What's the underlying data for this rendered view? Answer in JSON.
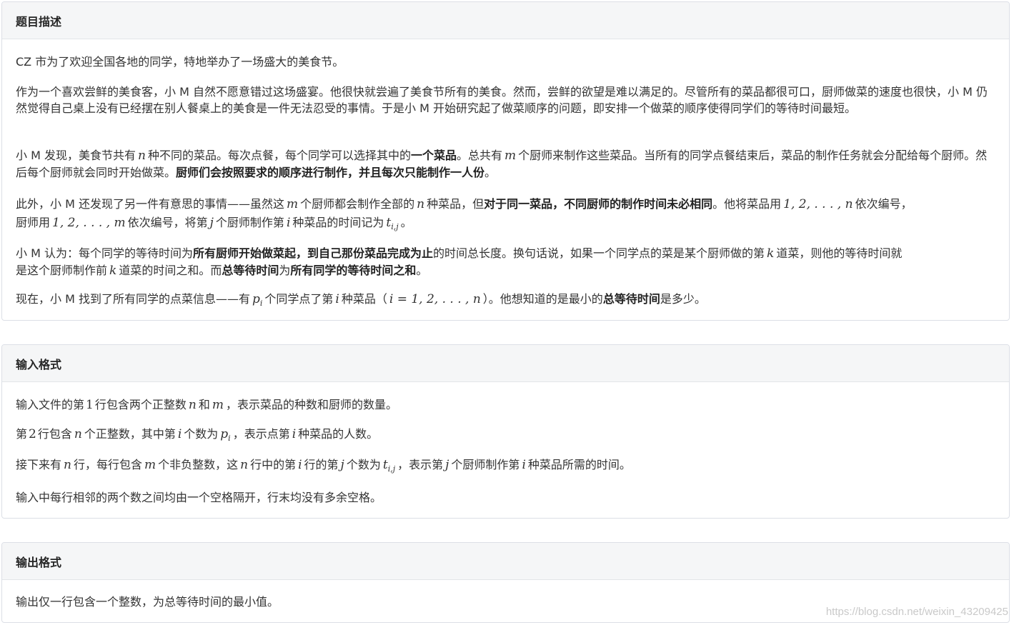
{
  "sections": {
    "description": {
      "title": "题目描述",
      "p1": "CZ 市为了欢迎全国各地的同学，特地举办了一场盛大的美食节。",
      "p2": "作为一个喜欢尝鲜的美食客，小 M 自然不愿意错过这场盛宴。他很快就尝遍了美食节所有的美食。然而，尝鲜的欲望是难以满足的。尽管所有的菜品都很可口，厨师做菜的速度也很快，小 M 仍然觉得自己桌上没有已经摆在别人餐桌上的美食是一件无法忍受的事情。于是小 M 开始研究起了做菜顺序的问题，即安排一个做菜的顺序使得同学们的等待时间最短。",
      "p3": {
        "a": "小 M 发现，美食节共有",
        "n": "n",
        "b": "种不同的菜品。每次点餐，每个同学可以选择其中的",
        "bold1": "一个菜品",
        "c": "。总共有",
        "m": "m",
        "d": "个厨师来制作这些菜品。当所有的同学点餐结束后，菜品的制作任务就会分配给每个厨师。然后每个厨师就会同时开始做菜。",
        "bold2": "厨师们会按照要求的顺序进行制作，并且每次只能制作一人份",
        "e": "。"
      },
      "p4": {
        "a": "此外，小 M 还发现了另一件有意思的事情——虽然这",
        "m": "m",
        "b": "个厨师都会制作全部的",
        "n": "n",
        "c": "种菜品，但",
        "bold1": "对于同一菜品，不同厨师的制作时间未必相同",
        "d": "。他将菜品用",
        "seq_n": "1, 2, . . . , n",
        "e": "依次编号，",
        "f": "厨师用",
        "seq_m": "1, 2, . . . , m",
        "g": "依次编号，将第",
        "j": "j",
        "h": "个厨师制作第",
        "i": "i",
        "k": "种菜品的时间记为",
        "t": "t",
        "tsub": "i,j",
        "end": "。"
      },
      "p5": {
        "a": "小 M 认为：每个同学的等待时间为",
        "bold1": "所有厨师开始做菜起，到自己那份菜品完成为止",
        "b": "的时间总长度。换句话说，如果一个同学点的菜是某个厨师做的第",
        "k1": "k",
        "c": "道菜，则他的等待时间就",
        "d": "是这个厨师制作前",
        "k2": "k",
        "e": "道菜的时间之和。而",
        "bold2": "总等待时间",
        "f": "为",
        "bold3": "所有同学的等待时间之和",
        "g": "。"
      },
      "p6": {
        "a": "现在，小 M 找到了所有同学的点菜信息——有",
        "p": "p",
        "psub": "i",
        "b": "个同学点了第",
        "i": "i",
        "c": "种菜品（",
        "range": "i = 1, 2, . . . , n",
        "d": "）。他想知道的是最小的",
        "bold1": "总等待时间",
        "e": "是多少。"
      }
    },
    "input": {
      "title": "输入格式",
      "l1": {
        "a": "输入文件的第",
        "one": "1",
        "b": "行包含两个正整数",
        "n": "n",
        "c": "和",
        "m": "m",
        "d": "，表示菜品的种数和厨师的数量。"
      },
      "l2": {
        "a": "第",
        "two": "2",
        "b": "行包含",
        "n": "n",
        "c": "个正整数，其中第",
        "i": "i",
        "d": "个数为",
        "p": "p",
        "psub": "i",
        "e": "，表示点第",
        "i2": "i",
        "f": "种菜品的人数。"
      },
      "l3": {
        "a": "接下来有",
        "n": "n",
        "b": "行，每行包含",
        "m": "m",
        "c": "个非负整数，这",
        "n2": "n",
        "d": "行中的第",
        "i": "i",
        "e": "行的第",
        "j": "j",
        "f": "个数为",
        "t": "t",
        "tsub": "i,j",
        "g": "，表示第",
        "j2": "j",
        "h": "个厨师制作第",
        "i2": "i",
        "k": "种菜品所需的时间。"
      },
      "l4": "输入中每行相邻的两个数之间均由一个空格隔开，行末均没有多余空格。"
    },
    "output": {
      "title": "输出格式",
      "l1": "输出仅一行包含一个整数，为总等待时间的最小值。"
    }
  },
  "watermark": "https://blog.csdn.net/weixin_43209425"
}
